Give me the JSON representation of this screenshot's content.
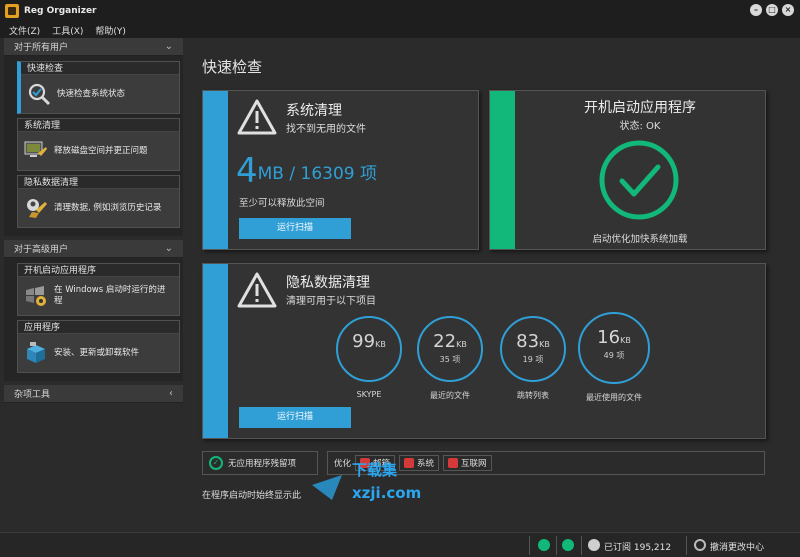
{
  "window": {
    "title": "Reg Organizer",
    "buttons": [
      "–",
      "□",
      "×"
    ]
  },
  "menu": [
    "文件(Z)",
    "工具(X)",
    "帮助(Y)"
  ],
  "sidebar": {
    "all_users": {
      "header": "对于所有用户",
      "items": [
        {
          "title": "快速检查",
          "desc": "快速检查系统状态",
          "icon": "magnifier-check-icon"
        },
        {
          "title": "系统清理",
          "desc": "释放磁盘空间并更正问题",
          "icon": "broom-monitor-icon"
        },
        {
          "title": "隐私数据清理",
          "desc": "清理数据, 例如浏览历史记录",
          "icon": "privacy-broom-icon"
        }
      ]
    },
    "advanced_users": {
      "header": "对于高级用户",
      "items": [
        {
          "title": "开机启动应用程序",
          "desc": "在 Windows 启动时运行的进程",
          "icon": "windows-gear-icon"
        },
        {
          "title": "应用程序",
          "desc": "安装、更新或卸载软件",
          "icon": "package-box-icon"
        }
      ]
    },
    "misc": {
      "header": "杂项工具"
    }
  },
  "main": {
    "title": "快速检查",
    "system_cleanup": {
      "title": "系统清理",
      "subtitle": "找不到无用的文件",
      "size_big": "4",
      "size_unit": "MB",
      "size_rest": " / 16309 项",
      "note": "至少可以释放此空间",
      "button": "运行扫描"
    },
    "startup": {
      "title": "开机启动应用程序",
      "status": "状态: OK",
      "note": "启动优化加快系统加载"
    },
    "privacy": {
      "title": "隐私数据清理",
      "subtitle": "清理可用于以下项目",
      "button": "运行扫描",
      "items": [
        {
          "num": "99",
          "unit": "KB",
          "count": "",
          "label": "SKYPE"
        },
        {
          "num": "22",
          "unit": "KB",
          "count": "35 项",
          "label": "最近的文件"
        },
        {
          "num": "83",
          "unit": "KB",
          "count": "19 项",
          "label": "跳转列表"
        },
        {
          "num": "16",
          "unit": "KB",
          "count": "49 项",
          "label": "最近使用的文件"
        }
      ]
    },
    "bottom": {
      "leftover": "无应用程序残留项",
      "optimize": "优化",
      "tags": [
        "邮箱",
        "系统",
        "互联网"
      ],
      "startup_note": "在程序启动时始终显示此",
      "watermark": "下载集 xzji.com"
    }
  },
  "status_bar": {
    "subscribed": "已订阅 195,212",
    "undo": "撤消更改中心"
  },
  "colors": {
    "accent_blue": "#2f9fd6",
    "accent_green": "#12b77a"
  }
}
